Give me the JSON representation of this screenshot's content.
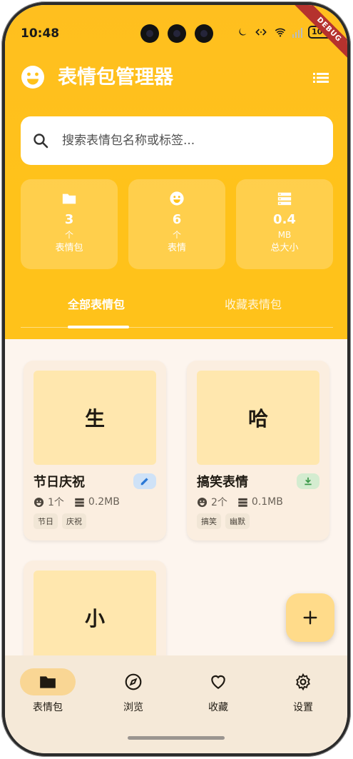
{
  "status_bar": {
    "time": "10:48",
    "battery": "100"
  },
  "debug_banner": "DEBUG",
  "app": {
    "title": "表情包管理器"
  },
  "search": {
    "placeholder": "搜索表情包名称或标签..."
  },
  "stats": [
    {
      "icon": "folder-icon",
      "value": "3",
      "unit": "个",
      "label": "表情包"
    },
    {
      "icon": "smiley-icon",
      "value": "6",
      "unit": "个",
      "label": "表情"
    },
    {
      "icon": "storage-icon",
      "value": "0.4",
      "unit": "MB",
      "label": "总大小"
    }
  ],
  "tabs": {
    "all": "全部表情包",
    "favorites": "收藏表情包"
  },
  "packs": [
    {
      "thumb": "生",
      "name": "节日庆祝",
      "badge": "edit-icon",
      "count": "1个",
      "size": "0.2MB",
      "tags": [
        "节日",
        "庆祝"
      ]
    },
    {
      "thumb": "哈",
      "name": "搞笑表情",
      "badge": "download-icon",
      "count": "2个",
      "size": "0.1MB",
      "tags": [
        "搞笑",
        "幽默"
      ]
    },
    {
      "thumb": "小"
    }
  ],
  "fab": {
    "icon": "plus-icon"
  },
  "nav": [
    {
      "label": "表情包",
      "icon": "folder-icon",
      "active": true
    },
    {
      "label": "浏览",
      "icon": "compass-icon",
      "active": false
    },
    {
      "label": "收藏",
      "icon": "heart-icon",
      "active": false
    },
    {
      "label": "设置",
      "icon": "gear-icon",
      "active": false
    }
  ],
  "colors": {
    "primary": "#FFC21A",
    "background": "#FDF5EE",
    "card": "#FBEEE0",
    "thumb": "#FFE7AE",
    "fab": "#FFDB8A",
    "edit_badge": "#CFE2F7",
    "download_badge": "#D4ECD0"
  }
}
